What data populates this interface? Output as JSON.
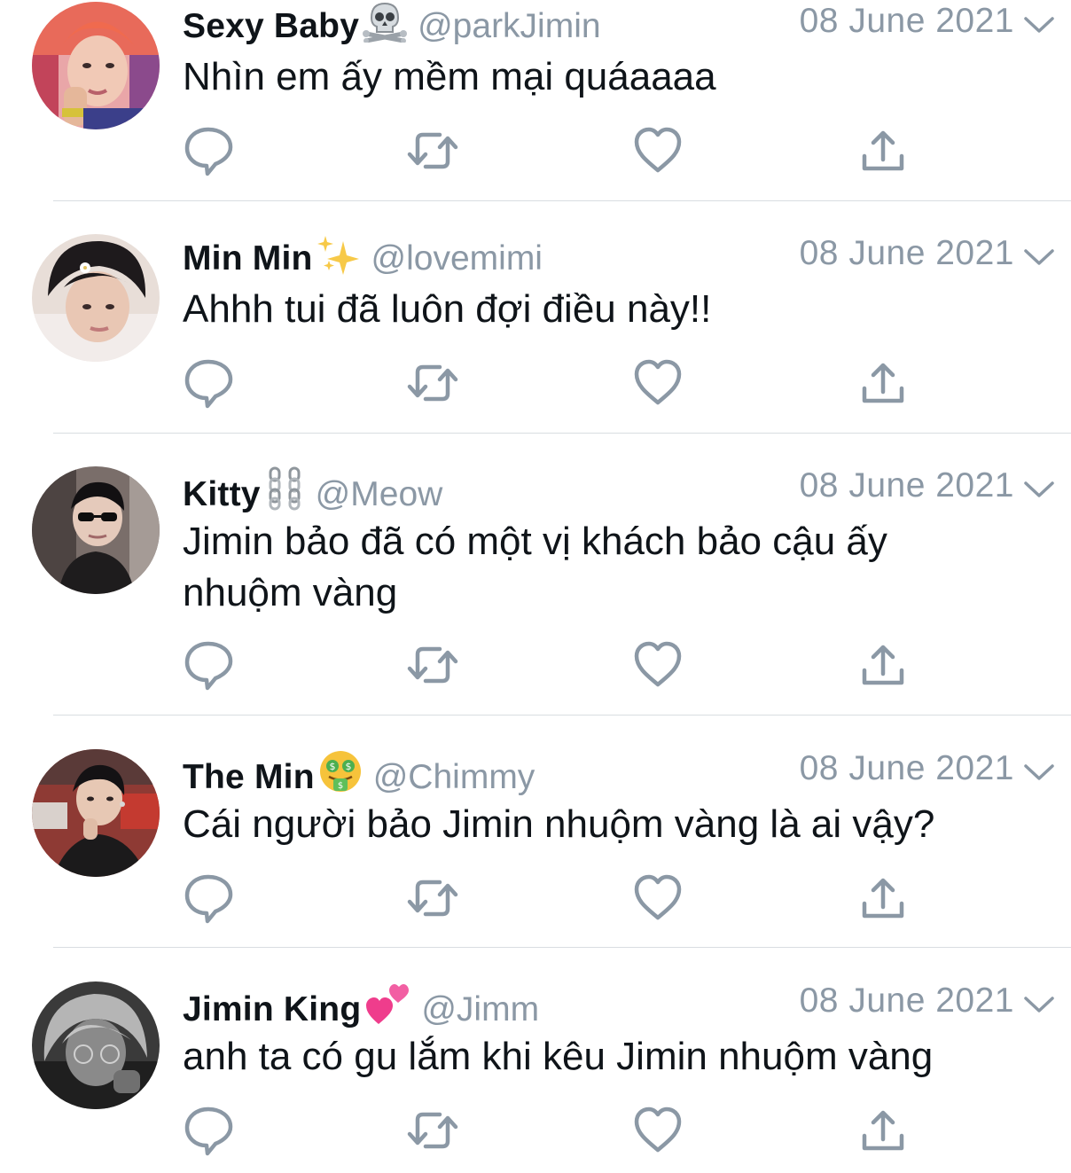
{
  "colors": {
    "text": "#0f1419",
    "secondary": "#8b98a5",
    "divider": "#d9dde1",
    "background": "#ffffff"
  },
  "icons": {
    "reply": "comment-bubble-icon",
    "retweet": "retweet-icon",
    "like": "heart-icon",
    "share": "share-upload-icon",
    "more": "chevron-down-icon"
  },
  "tweets": [
    {
      "name": "Sexy Baby",
      "emoji": "☠️",
      "emoji_icon": "skull-crossbones-icon",
      "handle": "@parkJimin",
      "date": "08 June 2021",
      "text": "Nhìn em ấy mềm mại quáaaaa"
    },
    {
      "name": "Min Min",
      "emoji": "✨",
      "emoji_icon": "sparkles-icon",
      "handle": "@lovemimi",
      "date": "08 June 2021",
      "text": "Ahhh tui đã luôn đợi điều này!!"
    },
    {
      "name": "Kitty",
      "emoji": "⛓️",
      "emoji_icon": "chains-icon",
      "handle": "@Meow",
      "date": "08 June 2021",
      "text": "Jimin bảo đã có một vị khách bảo cậu ấy nhuộm vàng"
    },
    {
      "name": "The Min",
      "emoji": "🤑",
      "emoji_icon": "money-mouth-face-icon",
      "handle": "@Chimmy",
      "date": "08 June 2021",
      "text": "Cái người bảo Jimin nhuộm vàng là ai vậy?"
    },
    {
      "name": "Jimin King",
      "emoji": "💕",
      "emoji_icon": "two-hearts-icon",
      "handle": "@Jimm",
      "date": "08 June 2021",
      "text": "anh ta có gu lắm khi kêu Jimin nhuộm vàng"
    }
  ]
}
